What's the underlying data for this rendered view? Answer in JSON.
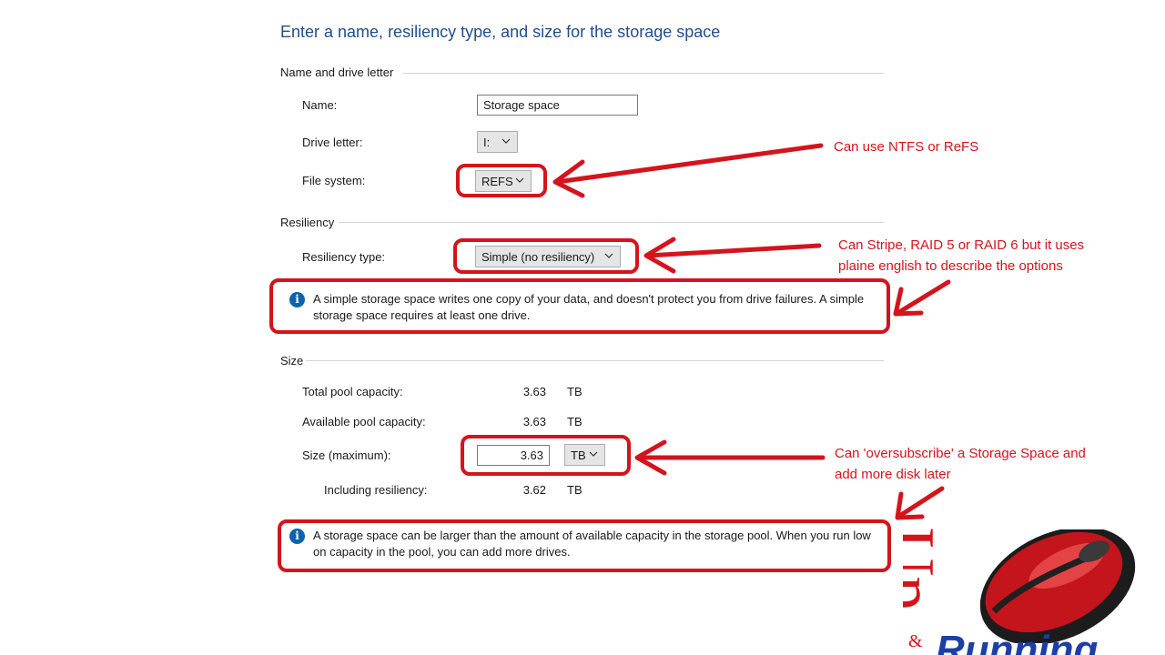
{
  "heading": "Enter a name, resiliency type, and size for the storage space",
  "sections": {
    "name_drive": "Name and drive letter",
    "resiliency": "Resiliency",
    "size": "Size"
  },
  "fields": {
    "name_label": "Name:",
    "name_value": "Storage space",
    "drive_label": "Drive letter:",
    "drive_value": "I:",
    "fs_label": "File system:",
    "fs_value": "REFS",
    "res_label": "Resiliency type:",
    "res_value": "Simple (no resiliency)",
    "res_info": "A simple storage space writes one copy of your data, and doesn't protect you from drive failures. A simple storage space requires at least one drive.",
    "total_label": "Total pool capacity:",
    "total_value": "3.63",
    "total_unit": "TB",
    "avail_label": "Available pool capacity:",
    "avail_value": "3.63",
    "avail_unit": "TB",
    "size_label": "Size (maximum):",
    "size_value": "3.63",
    "size_unit": "TB",
    "incl_label": "Including resiliency:",
    "incl_value": "3.62",
    "incl_unit": "TB",
    "size_info": "A storage space can be larger than the amount of available capacity in the storage pool. When you run low on capacity in the pool, you can add more drives."
  },
  "annotations": {
    "fs": "Can use NTFS or ReFS",
    "res_line1": "Can Stripe, RAID 5 or RAID 6 but it uses",
    "res_line2": "plaine english to describe the options",
    "size_line1": "Can 'oversubscribe' a Storage Space and",
    "size_line2": "add more disk later"
  },
  "logo": {
    "up": "Up",
    "amp": "&",
    "running": "Running"
  },
  "colors": {
    "annotation_red": "#d4141c",
    "heading_blue": "#1f4e8c",
    "info_blue": "#0a64ad",
    "logo_blue": "#1d3ea8"
  },
  "icons": [
    "info-icon",
    "chevron-down-icon",
    "arrow-icon",
    "mouse-logo-icon"
  ]
}
